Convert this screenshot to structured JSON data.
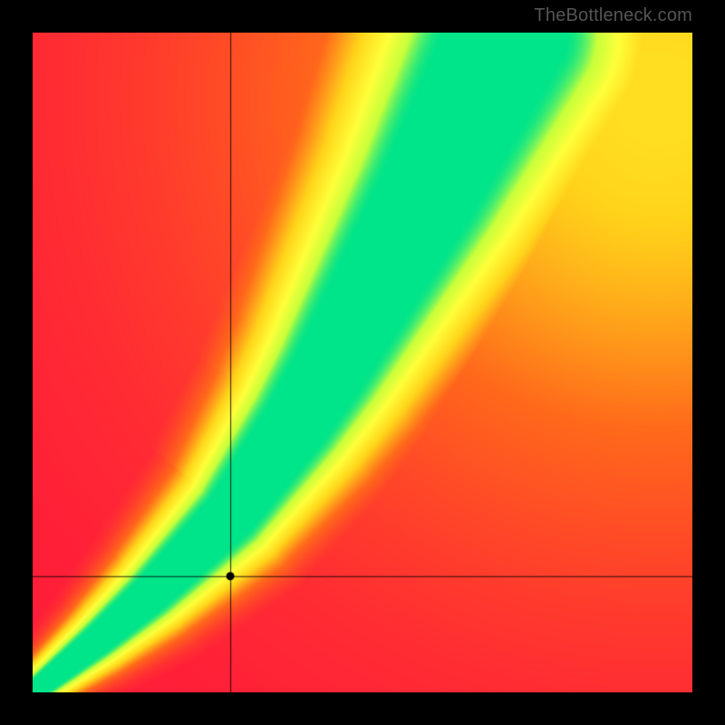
{
  "watermark": "TheBottleneck.com",
  "chart_data": {
    "type": "heatmap",
    "title": "",
    "xlabel": "",
    "ylabel": "",
    "xlim": [
      0,
      1
    ],
    "ylim": [
      0,
      1
    ],
    "marker": {
      "x": 0.3,
      "y": 0.175
    },
    "crosshair": true,
    "colorscale": [
      {
        "t": 0.0,
        "hex": "#ff1a3a"
      },
      {
        "t": 0.35,
        "hex": "#ff6a1a"
      },
      {
        "t": 0.6,
        "hex": "#ffd41a"
      },
      {
        "t": 0.8,
        "hex": "#ffff3a"
      },
      {
        "t": 0.92,
        "hex": "#c8ff3a"
      },
      {
        "t": 1.0,
        "hex": "#00e48a"
      }
    ],
    "ridge": {
      "description": "Optimal pairing curve (green ridge) from lower-left to upper-center-right",
      "points_xy": [
        [
          0.0,
          0.0
        ],
        [
          0.1,
          0.08
        ],
        [
          0.18,
          0.15
        ],
        [
          0.25,
          0.22
        ],
        [
          0.3,
          0.27
        ],
        [
          0.35,
          0.34
        ],
        [
          0.4,
          0.41
        ],
        [
          0.45,
          0.49
        ],
        [
          0.5,
          0.58
        ],
        [
          0.55,
          0.67
        ],
        [
          0.6,
          0.76
        ],
        [
          0.65,
          0.86
        ],
        [
          0.7,
          0.96
        ],
        [
          0.72,
          1.0
        ]
      ],
      "width_start": 0.012,
      "width_end": 0.085,
      "halo_multiplier": 2.5,
      "upper_right_warmth_center": [
        0.95,
        0.9
      ]
    }
  }
}
